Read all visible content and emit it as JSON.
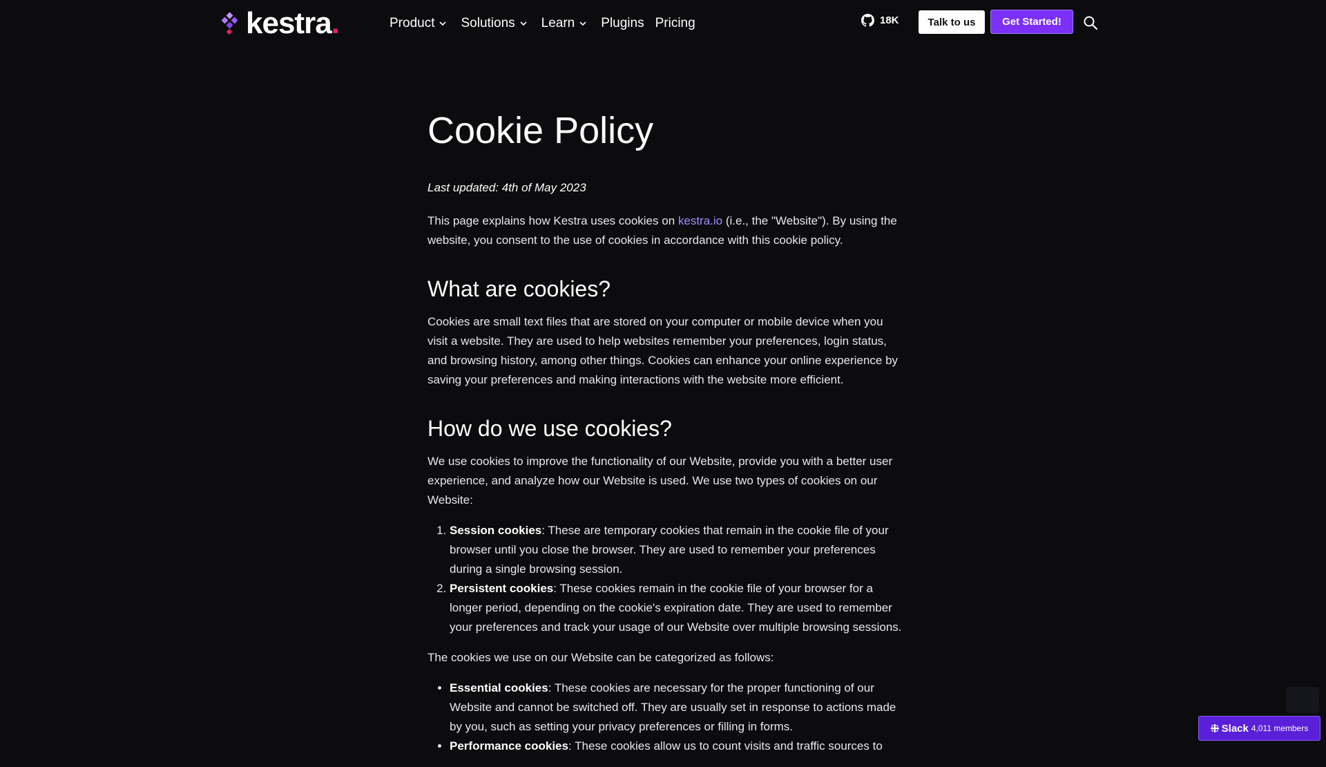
{
  "header": {
    "logo_text": "kestra",
    "logo_dot": ".",
    "nav": [
      {
        "label": "Product",
        "has_dropdown": true
      },
      {
        "label": "Solutions",
        "has_dropdown": true
      },
      {
        "label": "Learn",
        "has_dropdown": true
      },
      {
        "label": "Plugins",
        "has_dropdown": false
      },
      {
        "label": "Pricing",
        "has_dropdown": false
      }
    ],
    "github_stars": "18K",
    "talk_button": "Talk to us",
    "start_button": "Get Started!",
    "search_icon": "search-icon"
  },
  "page": {
    "title": "Cookie Policy",
    "last_updated": "Last updated: 4th of May 2023",
    "intro_before_link": "This page explains how Kestra uses cookies on ",
    "intro_link": "kestra.io",
    "intro_after_link": " (i.e., the \"Website\"). By using the website, you consent to the use of cookies in accordance with this cookie policy.",
    "section1_title": "What are cookies?",
    "section1_text": "Cookies are small text files that are stored on your computer or mobile device when you visit a website. They are used to help websites remember your preferences, login status, and browsing history, among other things. Cookies can enhance your online experience by saving your preferences and making interactions with the website more efficient.",
    "section2_title": "How do we use cookies?",
    "section2_text": "We use cookies to improve the functionality of our Website, provide you with a better user experience, and analyze how our Website is used. We use two types of cookies on our Website:",
    "types": [
      {
        "name": "Session cookies",
        "text": ": These are temporary cookies that remain in the cookie file of your browser until you close the browser. They are used to remember your preferences during a single browsing session."
      },
      {
        "name": "Persistent cookies",
        "text": ": These cookies remain in the cookie file of your browser for a longer period, depending on the cookie's expiration date. They are used to remember your preferences and track your usage of our Website over multiple browsing sessions."
      }
    ],
    "categories_intro": "The cookies we use on our Website can be categorized as follows:",
    "categories": [
      {
        "name": "Essential cookies",
        "text": ": These cookies are necessary for the proper functioning of our Website and cannot be switched off. They are usually set in response to actions made by you, such as setting your privacy preferences or filling in forms."
      },
      {
        "name": "Performance cookies",
        "text": ": These cookies allow us to count visits and traffic sources to"
      }
    ]
  },
  "slack": {
    "label": "Slack",
    "members": "4,011 members"
  },
  "colors": {
    "background": "#0c0c0f",
    "accent": "#7b2ff7",
    "link": "#a38cff",
    "logo_dot": "#e0245e"
  }
}
